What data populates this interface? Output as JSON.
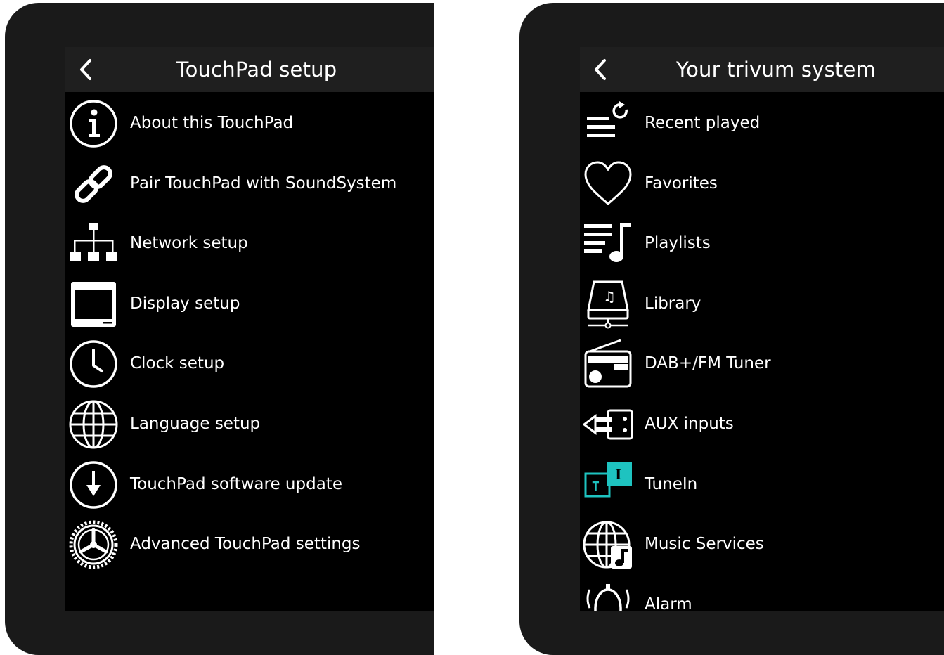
{
  "panels": [
    {
      "title": "TouchPad setup",
      "items": [
        {
          "label": "About this TouchPad",
          "icon": "info-icon"
        },
        {
          "label": "Pair TouchPad with SoundSystem",
          "icon": "link-icon"
        },
        {
          "label": "Network setup",
          "icon": "network-icon"
        },
        {
          "label": "Display setup",
          "icon": "display-icon"
        },
        {
          "label": "Clock setup",
          "icon": "clock-icon"
        },
        {
          "label": "Language setup",
          "icon": "globe-icon"
        },
        {
          "label": "TouchPad software update",
          "icon": "download-icon"
        },
        {
          "label": "Advanced TouchPad settings",
          "icon": "gear-icon"
        }
      ]
    },
    {
      "title": "Your trivum system",
      "items": [
        {
          "label": "Recent played",
          "icon": "recent-icon"
        },
        {
          "label": "Favorites",
          "icon": "heart-icon"
        },
        {
          "label": "Playlists",
          "icon": "playlist-icon"
        },
        {
          "label": "Library",
          "icon": "library-icon"
        },
        {
          "label": "DAB+/FM Tuner",
          "icon": "radio-icon"
        },
        {
          "label": "AUX inputs",
          "icon": "aux-icon"
        },
        {
          "label": "TuneIn",
          "icon": "tunein-icon"
        },
        {
          "label": "Music Services",
          "icon": "music-services-icon"
        },
        {
          "label": "Alarm",
          "icon": "alarm-icon"
        }
      ]
    }
  ],
  "colors": {
    "frame": "#1a1a1a",
    "screen": "#000000",
    "header": "#1f1f1f",
    "text": "#ffffff",
    "tunein_accent": "#1ec3c0"
  }
}
